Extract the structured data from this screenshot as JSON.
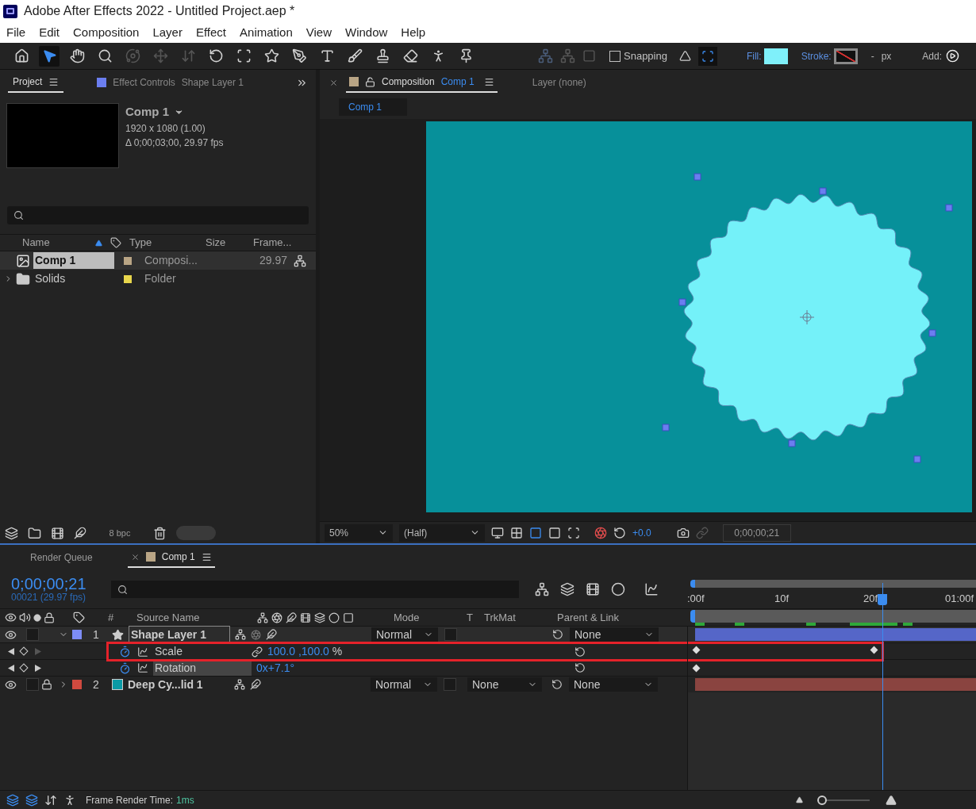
{
  "window": {
    "title": "Adobe After Effects 2022 - Untitled Project.aep *"
  },
  "menu": [
    "File",
    "Edit",
    "Composition",
    "Layer",
    "Effect",
    "Animation",
    "View",
    "Window",
    "Help"
  ],
  "toolbar": {
    "tools": [
      {
        "kind": "home",
        "selected": false
      },
      {
        "kind": "selection",
        "selected": true
      },
      {
        "kind": "hand",
        "selected": false
      },
      {
        "kind": "zoom",
        "selected": false
      },
      {
        "kind": "orbit",
        "selected": false
      },
      {
        "kind": "pan",
        "selected": false
      },
      {
        "kind": "dolly",
        "selected": false
      },
      {
        "kind": "rotate",
        "selected": false
      },
      {
        "kind": "anchor",
        "selected": false
      },
      {
        "kind": "star",
        "selected": false
      },
      {
        "kind": "pen",
        "selected": false
      },
      {
        "kind": "text",
        "selected": false
      },
      {
        "kind": "brush",
        "selected": false
      },
      {
        "kind": "stamp",
        "selected": false
      },
      {
        "kind": "eraser",
        "selected": false
      },
      {
        "kind": "puppet",
        "selected": false
      },
      {
        "kind": "pin",
        "selected": false
      }
    ],
    "snapping": {
      "label": "Snapping",
      "checked": false
    },
    "fill": {
      "label": "Fill:",
      "color": "#7ff0fa"
    },
    "stroke": {
      "label": "Stroke:",
      "width": "-",
      "unit": "px"
    },
    "add": {
      "label": "Add:"
    }
  },
  "project_panel": {
    "tabs": [
      {
        "label": "Project",
        "selected": true
      },
      {
        "label": "Effect Controls",
        "detail": "Shape Layer 1",
        "selected": false
      }
    ],
    "comp_info": {
      "name": "Comp 1",
      "size": "1920 x 1080 (1.00)",
      "duration": "Δ 0;00;03;00, 29.97 fps"
    },
    "columns": [
      "Name",
      "Type",
      "Size",
      "Frame..."
    ],
    "items": [
      {
        "kind": "composition",
        "name": "Comp 1",
        "color": "#b9a585",
        "type": "Composi...",
        "frame_rate": "29.97",
        "selected": true
      },
      {
        "kind": "folder",
        "name": "Solids",
        "color": "#e8d64c",
        "type": "Folder",
        "selected": false
      }
    ],
    "bit_depth": "8 bpc"
  },
  "composition_panel": {
    "tabs": [
      {
        "label": "Composition",
        "detail": "Comp 1",
        "selected": true
      },
      {
        "label": "Layer (none)",
        "selected": false
      }
    ],
    "viewer_tab": "Comp 1",
    "zoom": "50%",
    "resolution": "(Half)",
    "exposure": "+0.0",
    "timecode": "0;00;00;21"
  },
  "timeline": {
    "tabs": [
      {
        "label": "Render Queue",
        "selected": false
      },
      {
        "label": "Comp 1",
        "selected": true
      }
    ],
    "timecode": "0;00;00;21",
    "frame_info": "00021 (29.97 fps)",
    "columns": {
      "number": "#",
      "source_name": "Source Name",
      "mode": "Mode",
      "t": "T",
      "trkmat": "TrkMat",
      "parent": "Parent & Link"
    },
    "ruler": [
      ":00f",
      "10f",
      "20f",
      "01:00f"
    ],
    "layers": [
      {
        "number": "1",
        "kind": "shape",
        "name": "Shape Layer 1",
        "color": "#7d8cf5",
        "mode": "Normal",
        "parent": "None",
        "expanded": true,
        "locked": false,
        "selected": true,
        "properties": [
          {
            "name": "Scale",
            "value": "100.0 ,100.0",
            "unit": "%",
            "selected": false,
            "highlighted": true
          },
          {
            "name": "Rotation",
            "value": "0x+7.1°",
            "selected": true,
            "highlighted": false
          }
        ]
      },
      {
        "number": "2",
        "kind": "solid",
        "name": "Deep Cy...lid 1",
        "color": "#d04a3f",
        "mode": "Normal",
        "trkmat": "None",
        "parent": "None",
        "expanded": false,
        "locked": true,
        "selected": false
      }
    ]
  },
  "status_bar": {
    "label": "Frame Render Time:",
    "value": "1ms",
    "zoom_slider": {
      "level": 0
    }
  }
}
